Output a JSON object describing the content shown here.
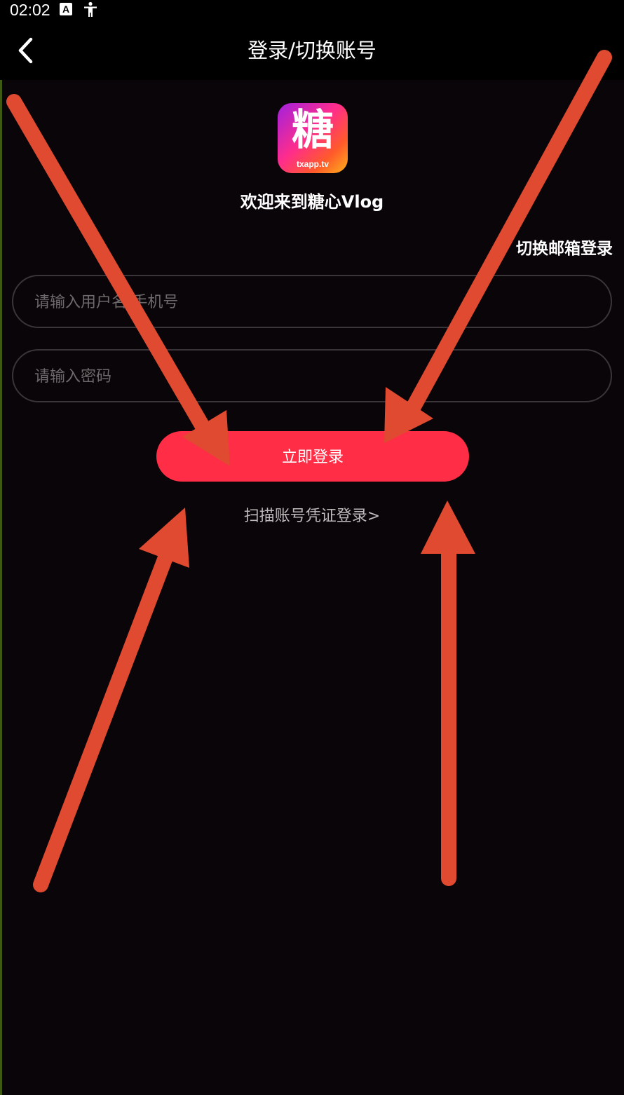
{
  "status_bar": {
    "time": "02:02",
    "icons": [
      "notification-a-icon",
      "accessibility-icon"
    ]
  },
  "nav": {
    "title": "登录/切换账号",
    "back_icon": "chevron-left-icon"
  },
  "logo": {
    "char": "糖",
    "domain": "txapp.tv"
  },
  "welcome": "欢迎来到糖心Vlog",
  "switch_email": "切换邮箱登录",
  "form": {
    "username_placeholder": "请输入用户名/手机号",
    "password_placeholder": "请输入密码"
  },
  "login_button": "立即登录",
  "scan_link": "扫描账号凭证登录>",
  "colors": {
    "background": "#0a0508",
    "accent": "#ff2d46",
    "arrow": "#e04a30"
  }
}
